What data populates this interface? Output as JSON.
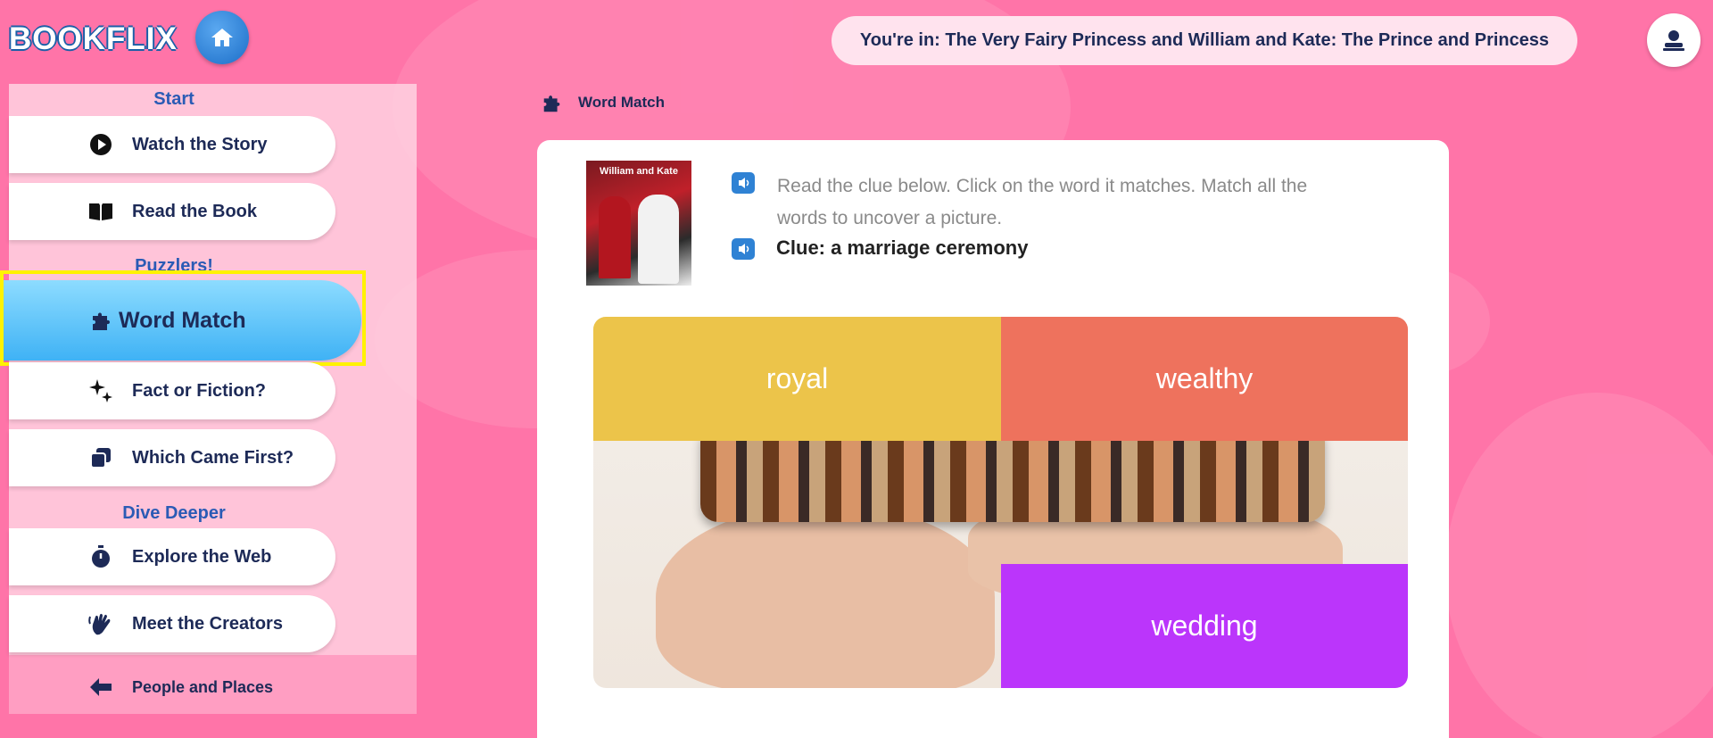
{
  "header": {
    "logo_text": "BOOKFLIX",
    "location": "You're in: The Very Fairy Princess and William and Kate: The Prince and Princess"
  },
  "sidebar": {
    "sections": {
      "start": "Start",
      "puzzlers": "Puzzlers!",
      "dive_deeper": "Dive Deeper"
    },
    "items": [
      {
        "label": "Watch the Story",
        "icon": "play-icon"
      },
      {
        "label": "Read the Book",
        "icon": "book-icon"
      },
      {
        "label": "Word Match",
        "icon": "puzzle-icon",
        "active": true
      },
      {
        "label": "Fact or Fiction?",
        "icon": "sparkle-icon"
      },
      {
        "label": "Which Came First?",
        "icon": "cards-icon"
      },
      {
        "label": "Explore the Web",
        "icon": "stopwatch-icon"
      },
      {
        "label": "Meet the Creators",
        "icon": "wave-hand-icon"
      }
    ],
    "back_link": "People and Places"
  },
  "main": {
    "heading": "Word Match",
    "book_cover_title": "William and Kate",
    "instructions": "Read the clue below. Click on the word it matches. Match all the words to uncover a picture.",
    "clue": "Clue: a marriage ceremony",
    "tiles": [
      "royal",
      "wealthy",
      "wedding"
    ]
  },
  "colors": {
    "background": "#ff74a8",
    "active_nav": "#3fb2f5",
    "tile_royal": "#ecc44a",
    "tile_wealthy": "#ee725d",
    "tile_wedding": "#bb35fb",
    "highlight": "#fff200"
  }
}
